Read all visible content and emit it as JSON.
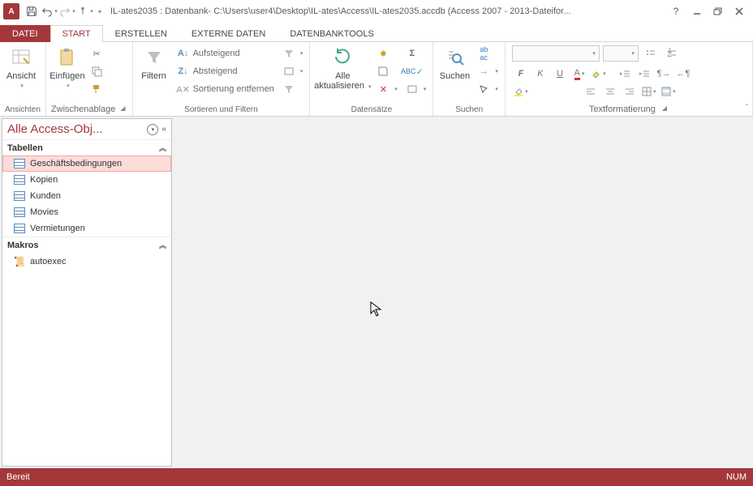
{
  "title": "IL-ates2035 : Datenbank- C:\\Users\\user4\\Desktop\\IL-ates\\Access\\IL-ates2035.accdb (Access 2007 - 2013-Dateifor...",
  "tabs": {
    "file": "DATEI",
    "start": "START",
    "erstellen": "ERSTELLEN",
    "externe": "EXTERNE DATEN",
    "dbtools": "DATENBANKTOOLS"
  },
  "groups": {
    "ansichten": "Ansichten",
    "zwischenablage": "Zwischenablage",
    "sortfilter": "Sortieren und Filtern",
    "datensaetze": "Datensätze",
    "suchen": "Suchen",
    "textfmt": "Textformatierung"
  },
  "buttons": {
    "ansicht": "Ansicht",
    "einfuegen": "Einfügen",
    "filtern": "Filtern",
    "aufsteigend": "Aufsteigend",
    "absteigend": "Absteigend",
    "sortentf": "Sortierung entfernen",
    "alleakt1": "Alle",
    "alleakt2": "aktualisieren",
    "suchen": "Suchen"
  },
  "nav": {
    "title": "Alle Access-Obj...",
    "sections": {
      "tabellen": "Tabellen",
      "makros": "Makros"
    },
    "tables": [
      "Geschäftsbedingungen",
      "Kopien",
      "Kunden",
      "Movies",
      "Vermietungen"
    ],
    "macros": [
      "autoexec"
    ]
  },
  "status": {
    "ready": "Bereit",
    "num": "NUM"
  }
}
